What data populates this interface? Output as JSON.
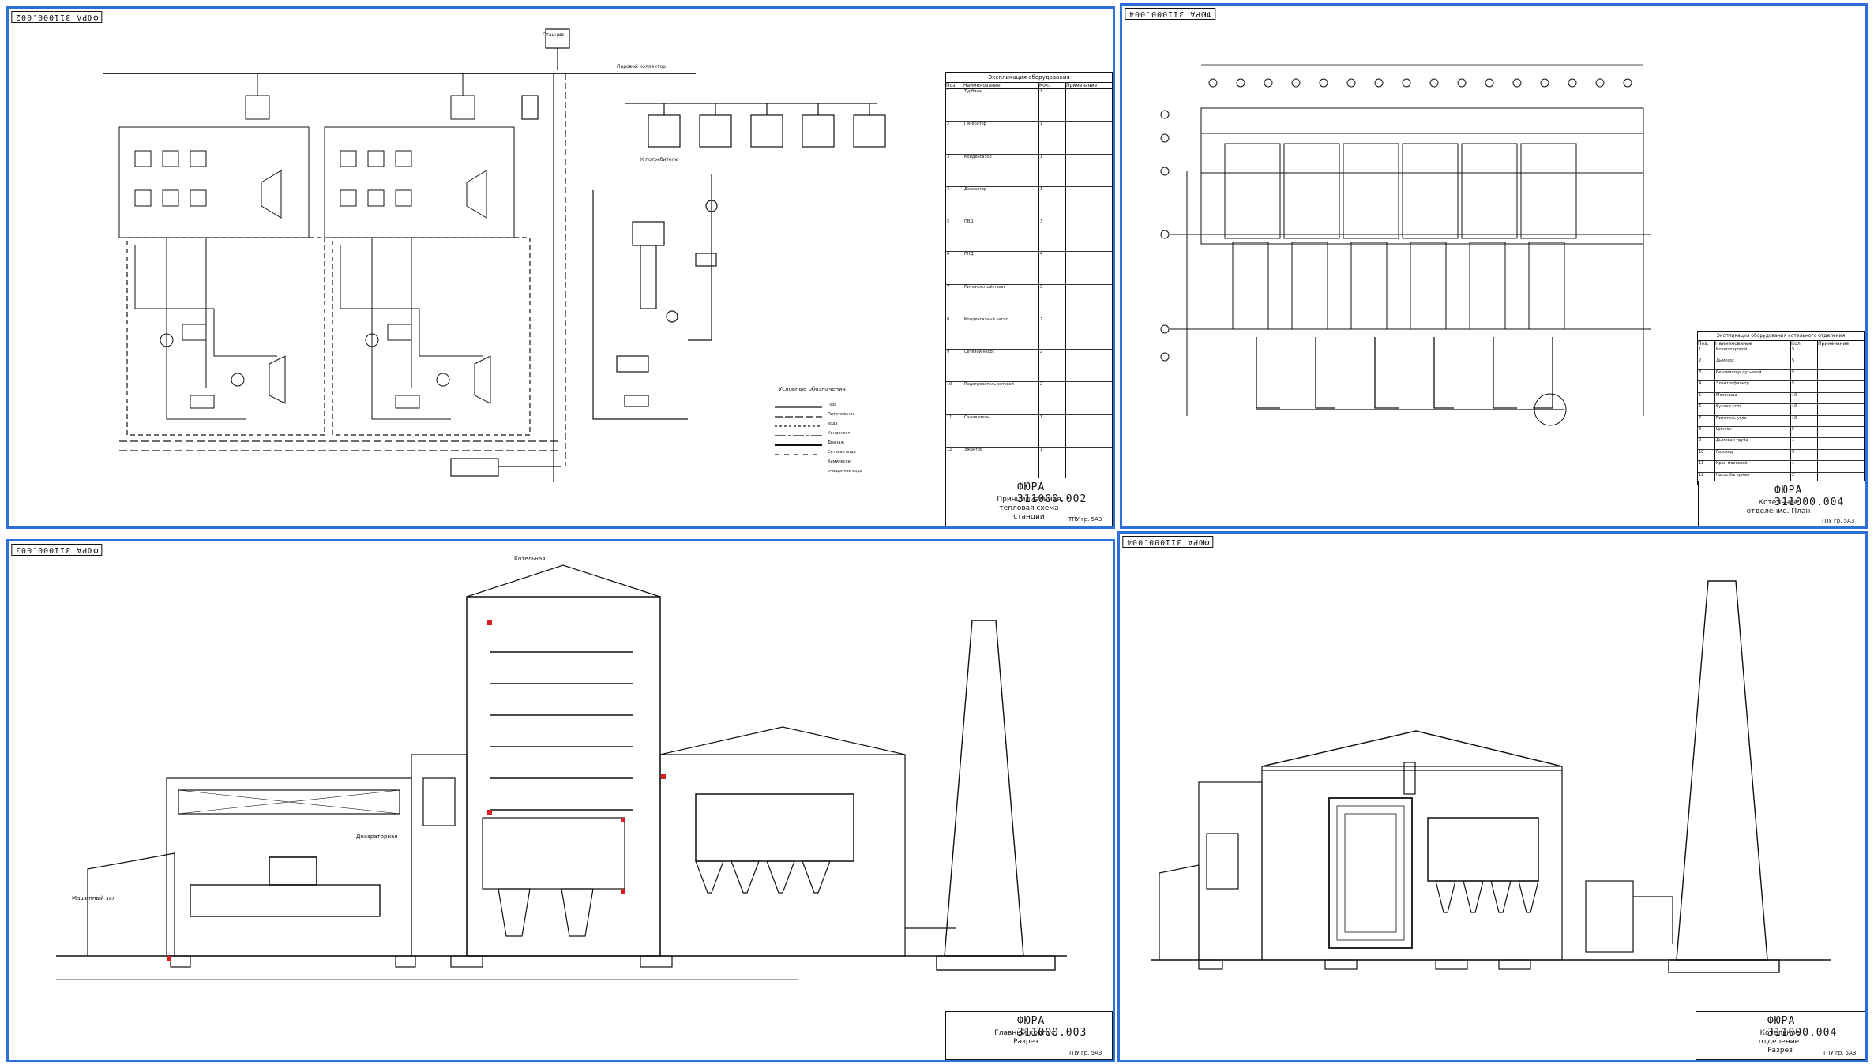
{
  "sheet1": {
    "corner_label": "ФЮРА 311000.002",
    "spec_title": "Экспликация оборудования",
    "spec_columns": [
      "Поз.",
      "Наименование",
      "Кол.",
      "Примечание"
    ],
    "spec_rows": [
      [
        "1",
        "Турбина",
        "1",
        ""
      ],
      [
        "2",
        "Генератор",
        "1",
        ""
      ],
      [
        "3",
        "Конденсатор",
        "1",
        ""
      ],
      [
        "4",
        "Деаэратор",
        "1",
        ""
      ],
      [
        "5",
        "ПВД",
        "3",
        ""
      ],
      [
        "6",
        "ПНД",
        "4",
        ""
      ],
      [
        "7",
        "Питательный насос",
        "2",
        ""
      ],
      [
        "8",
        "Конденсатный насос",
        "2",
        ""
      ],
      [
        "9",
        "Сетевой насос",
        "2",
        ""
      ],
      [
        "10",
        "Подогреватель сетевой",
        "2",
        ""
      ],
      [
        "11",
        "Охладитель",
        "1",
        ""
      ],
      [
        "12",
        "Эжектор",
        "1",
        ""
      ]
    ],
    "legend_title": "Условные обозначения",
    "legend_items": [
      "Пар",
      "Питательная вода",
      "Конденсат",
      "Дренаж",
      "Сетевая вода",
      "Химически очищенная вода"
    ],
    "label_station": "Станция",
    "label_collector": "Паровой коллектор",
    "label_consumer": "К потребителю",
    "tb_code": "ФЮРА 311000.002",
    "tb_title_1": "Принципиальная",
    "tb_title_2": "тепловая схема",
    "tb_title_3": "станции",
    "tb_org": "ТПУ гр. 5А3"
  },
  "sheet2": {
    "corner_label": "ФЮРА 311000.004",
    "spec_title": "Экспликация оборудования котельного отделения",
    "spec_columns": [
      "Поз.",
      "Наименование",
      "Кол.",
      "Примечание"
    ],
    "spec_rows": [
      [
        "1",
        "Котел паровой",
        "5",
        ""
      ],
      [
        "2",
        "Дымосос",
        "5",
        ""
      ],
      [
        "3",
        "Вентилятор дутьевой",
        "5",
        ""
      ],
      [
        "4",
        "Электрофильтр",
        "5",
        ""
      ],
      [
        "5",
        "Мельница",
        "10",
        ""
      ],
      [
        "6",
        "Бункер угля",
        "10",
        ""
      ],
      [
        "7",
        "Питатель угля",
        "10",
        ""
      ],
      [
        "8",
        "Циклон",
        "5",
        ""
      ],
      [
        "9",
        "Дымовая труба",
        "1",
        ""
      ],
      [
        "10",
        "Газоход",
        "5",
        ""
      ],
      [
        "11",
        "Кран мостовой",
        "1",
        ""
      ],
      [
        "12",
        "Насос багерный",
        "2",
        ""
      ]
    ],
    "tb_code": "ФЮРА 311000.004",
    "tb_title_1": "Котельное",
    "tb_title_2": "отделение. План",
    "tb_org": "ТПУ гр. 5А3"
  },
  "sheet3": {
    "corner_label": "ФЮРА 311000.003",
    "label_room_1": "Машинный зал",
    "label_room_2": "Деаэраторная",
    "label_room_3": "Котельная",
    "tb_code": "ФЮРА 311000.003",
    "tb_title_1": "Главный корпус.",
    "tb_title_2": "Разрез",
    "tb_org": "ТПУ гр. 5А3"
  },
  "sheet4": {
    "corner_label": "ФЮРА 311000.004",
    "tb_code": "ФЮРА 311000.004",
    "tb_title_1": "Котельное отделение.",
    "tb_title_2": "Разрез",
    "tb_org": "ТПУ гр. 5А3"
  },
  "colors": {
    "sheet_border": "#2e6fd8",
    "line": "#111111",
    "accent_red": "#d81e1e"
  }
}
